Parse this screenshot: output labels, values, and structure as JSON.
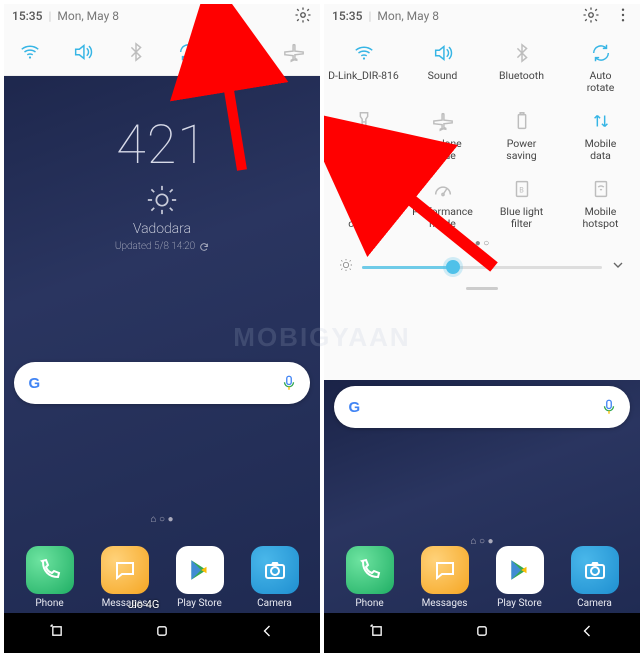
{
  "status": {
    "time": "15:35",
    "date": "Mon, May 8"
  },
  "lock": {
    "time": "421",
    "city": "Vadodara",
    "updated": "Updated 5/8 14:20"
  },
  "dock": {
    "phone": "Phone",
    "messages": "Messages",
    "play": "Play Store",
    "camera": "Camera"
  },
  "carrier": "Jio 4G",
  "watermark": "MOBIGYAAN",
  "tiles": {
    "r1": [
      "D-Link_DIR-816",
      "Sound",
      "Bluetooth",
      "Auto\nrotate"
    ],
    "r2": [
      "Flashlight",
      "Airplane\nmode",
      "Power\nsaving",
      "Mobile\ndata"
    ],
    "r3": [
      "Wi-Fi\ncalling",
      "Performance\nmode",
      "Blue light\nfilter",
      "Mobile\nhotspot"
    ]
  },
  "brightness_pct": 38
}
